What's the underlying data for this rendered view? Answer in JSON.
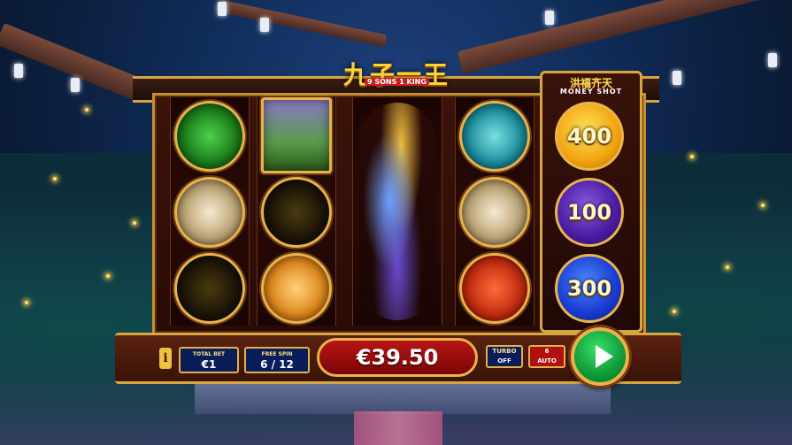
{
  "game": {
    "logo_text": "九子一王",
    "logo_sub": "9 SONS 1 KING"
  },
  "money_shot": {
    "title": "洪福齐天",
    "subtitle": "MONEY SHOT",
    "coins": [
      {
        "value": "400",
        "color": "gold"
      },
      {
        "value": "100",
        "color": "purple"
      },
      {
        "value": "300",
        "color": "blue"
      }
    ]
  },
  "reels": [
    [
      "green-beast-symbol",
      "ox-symbol",
      "toad-symbol"
    ],
    [
      "palace-symbol",
      "toad-symbol",
      "tiger-symbol"
    ],
    [
      "dragon-wild-symbol"
    ],
    [
      "blue-lion-symbol",
      "ox-symbol",
      "red-lion-symbol"
    ]
  ],
  "controls": {
    "info_label": "i",
    "total_bet_label": "TOTAL BET",
    "total_bet_value": "€1",
    "free_spin_label": "FREE SPIN",
    "free_spin_value": "6 / 12",
    "balance": "€39.50",
    "turbo_label": "TURBO",
    "turbo_state": "OFF",
    "auto_count": "6",
    "auto_label": "AUTO"
  },
  "colors": {
    "frame_gold": "#d8a640",
    "balance_red": "#b81414",
    "spin_green": "#1fbf4f"
  }
}
